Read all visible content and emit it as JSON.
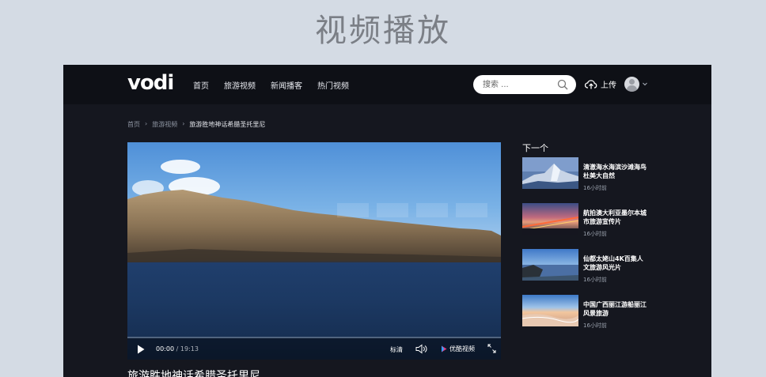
{
  "page_title": "视频播放",
  "logo": "vodi",
  "nav": [
    "首页",
    "旅游视频",
    "新闻播客",
    "热门视频"
  ],
  "search": {
    "placeholder": "搜索 ..."
  },
  "upload_label": "上传",
  "breadcrumb": {
    "home": "首页",
    "category": "旅游视频",
    "current": "旅游胜地神话希腊圣托里尼"
  },
  "player": {
    "current_time": "00:00",
    "separator": "/",
    "total_time": "19:13",
    "quality": "标清",
    "brand": "优酷视频",
    "progress_fraction": 0
  },
  "video_title": "旅游胜地神话希腊圣托里尼",
  "next": {
    "heading": "下一个",
    "items": [
      {
        "title": "清澈海水海滨沙滩海鸟杜美大自然",
        "time": "16小时前"
      },
      {
        "title": "航拍澳大利亚墨尔本城市旅游宣传片",
        "time": "16小时前"
      },
      {
        "title": "仙都太姥山4K百集人文旅游风光片",
        "time": "16小时前"
      },
      {
        "title": "中国广西丽江游船丽江风景旅游",
        "time": "16小时前"
      }
    ]
  },
  "colors": {
    "background": "#d4dbe4",
    "frame": "#15171f",
    "topbar": "#0e1016",
    "accent": "#ffffff"
  }
}
